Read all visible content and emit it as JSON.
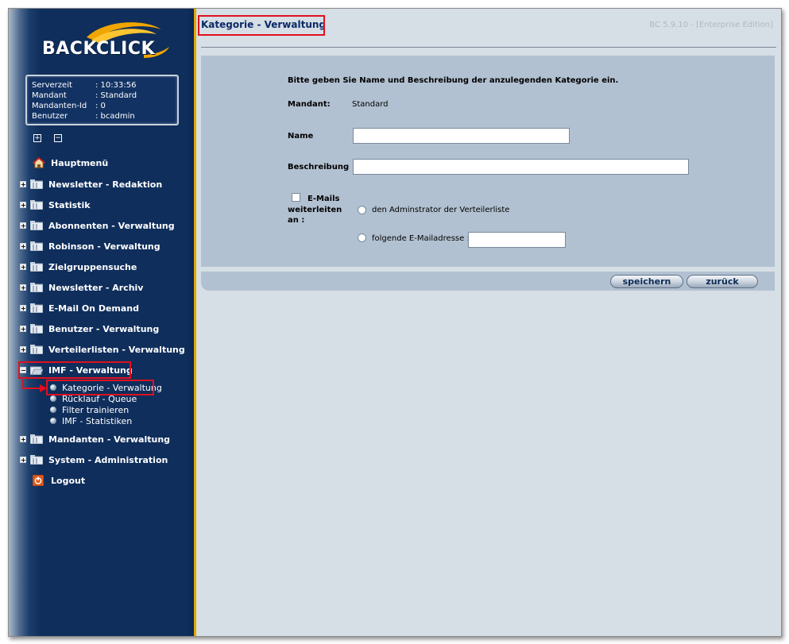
{
  "logo": {
    "text": "BACKCLICK"
  },
  "info": [
    {
      "key": "Serverzeit",
      "value": ": 10:33:56"
    },
    {
      "key": "Mandant",
      "value": ": Standard"
    },
    {
      "key": "Mandanten-Id",
      "value": ": 0"
    },
    {
      "key": "Benutzer",
      "value": ": bcadmin"
    }
  ],
  "tree_controls": {
    "expand_icon": "+",
    "collapse_icon": "−"
  },
  "menu": [
    {
      "label": "Hauptmenü",
      "icon": "home-icon"
    },
    {
      "label": "Newsletter - Redaktion"
    },
    {
      "label": "Statistik"
    },
    {
      "label": "Abonnenten - Verwaltung"
    },
    {
      "label": "Robinson - Verwaltung"
    },
    {
      "label": "Zielgruppensuche"
    },
    {
      "label": "Newsletter - Archiv"
    },
    {
      "label": "E-Mail On Demand"
    },
    {
      "label": "Benutzer - Verwaltung"
    },
    {
      "label": "Verteilerlisten - Verwaltung"
    },
    {
      "label": "IMF - Verwaltung",
      "expanded": true
    },
    {
      "label": "Mandanten - Verwaltung"
    },
    {
      "label": "System - Administration"
    },
    {
      "label": "Logout",
      "icon": "power-icon"
    }
  ],
  "submenu": [
    {
      "label": "Kategorie - Verwaltung",
      "active": true
    },
    {
      "label": "Rücklauf - Queue"
    },
    {
      "label": "Filter trainieren"
    },
    {
      "label": "IMF - Statistiken"
    }
  ],
  "header": {
    "title": "Kategorie - Verwaltung",
    "version": "BC 5.9.10 - [Enterprise Edition]"
  },
  "form": {
    "instruction": "Bitte geben Sie Name und Beschreibung der anzulegenden Kategorie ein.",
    "mandant_label": "Mandant:",
    "mandant_value": "Standard",
    "name_label": "Name",
    "name_value": "",
    "beschreibung_label": "Beschreibung",
    "beschreibung_value": "",
    "forward_label_1": "E-Mails",
    "forward_label_2": "weiterleiten",
    "forward_label_3": "an :",
    "forward_checked": false,
    "option_admin": "den Adminstrator der Verteilerliste",
    "option_email": "folgende E-Mailadresse :",
    "email_value": ""
  },
  "buttons": {
    "save": "speichern",
    "back": "zurück"
  },
  "colors": {
    "sidebar": "#0f2e5c",
    "highlight": "#e0101e",
    "panel": "#b2c1d1",
    "accent": "#e0a800"
  }
}
